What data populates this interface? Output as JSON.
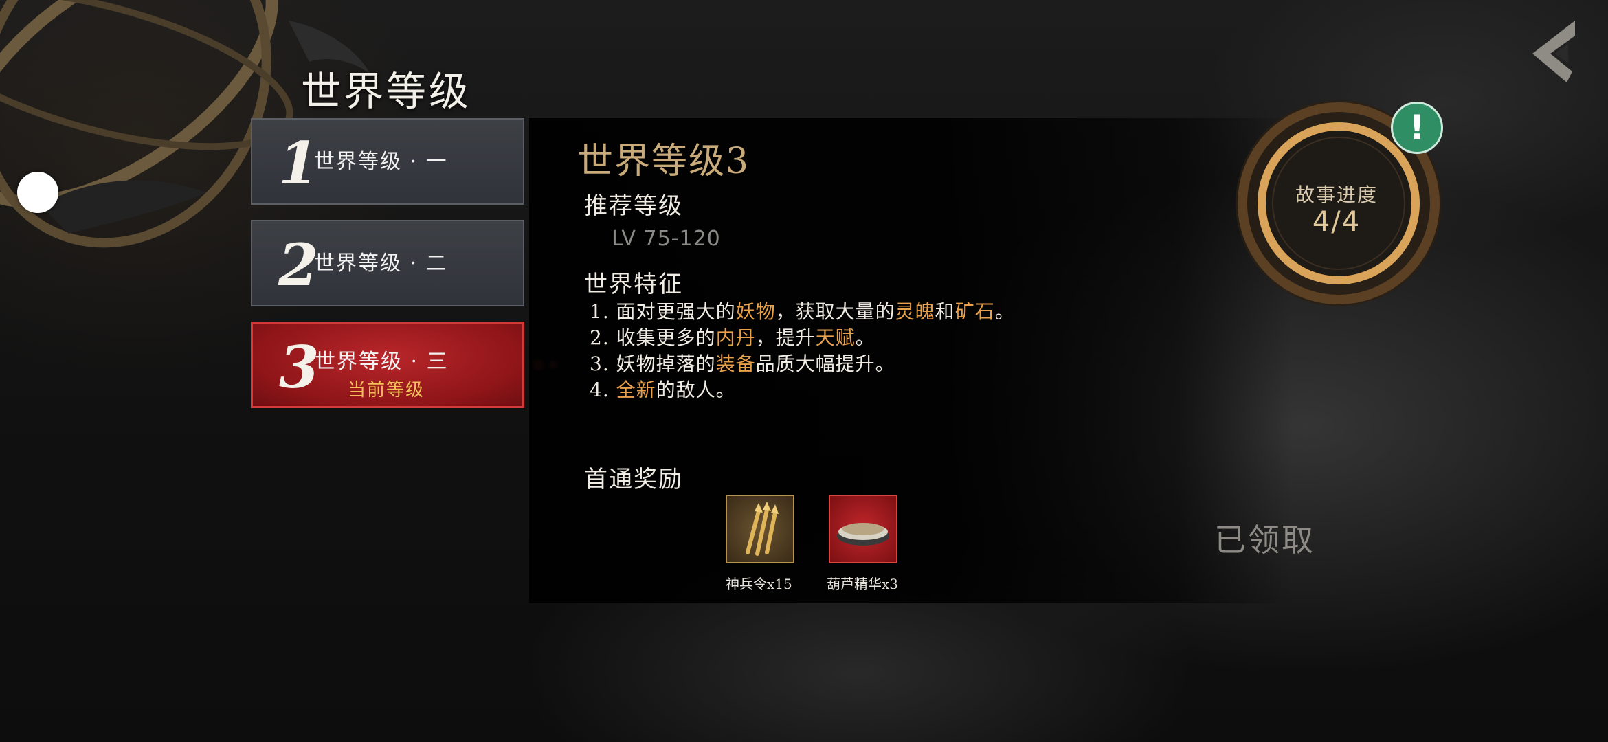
{
  "page_title": "世界等级",
  "levels": [
    {
      "num": "1",
      "label": "世界等级 · 一",
      "sub": ""
    },
    {
      "num": "2",
      "label": "世界等级 · 二",
      "sub": ""
    },
    {
      "num": "3",
      "label": "世界等级 · 三",
      "sub": "当前等级"
    }
  ],
  "selected_level_index": 2,
  "detail": {
    "title": "世界等级3",
    "recommended_heading": "推荐等级",
    "recommended_value": "LV 75-120",
    "features_heading": "世界特征",
    "features": [
      {
        "prefix": "1. 面对更强大的",
        "hl1": "妖物",
        "mid1": "，获取大量的",
        "hl2": "灵魄",
        "mid2": "和",
        "hl3": "矿石",
        "suffix": "。"
      },
      {
        "prefix": "2. 收集更多的",
        "hl1": "内丹",
        "mid1": "，提升",
        "hl2": "天赋",
        "suffix": "。"
      },
      {
        "prefix": "3. 妖物掉落的",
        "hl1": "装备",
        "suffix": "品质大幅提升。"
      },
      {
        "prefix": "4. ",
        "hl1": "全新",
        "suffix": "的敌人。"
      }
    ],
    "rewards_heading": "首通奖励",
    "rewards": [
      {
        "label": "神兵令x15",
        "icon": "golden-spears-icon"
      },
      {
        "label": "葫芦精华x3",
        "icon": "powder-bowl-icon"
      }
    ],
    "claim_status": "已领取"
  },
  "story_progress": {
    "title": "故事进度",
    "value": "4/4",
    "alert": "!"
  },
  "colors": {
    "highlight": "#e9a04b",
    "gold_title": "#c9aa7b",
    "active_tab": "#a11c1f",
    "alert": "#2f8e64"
  }
}
